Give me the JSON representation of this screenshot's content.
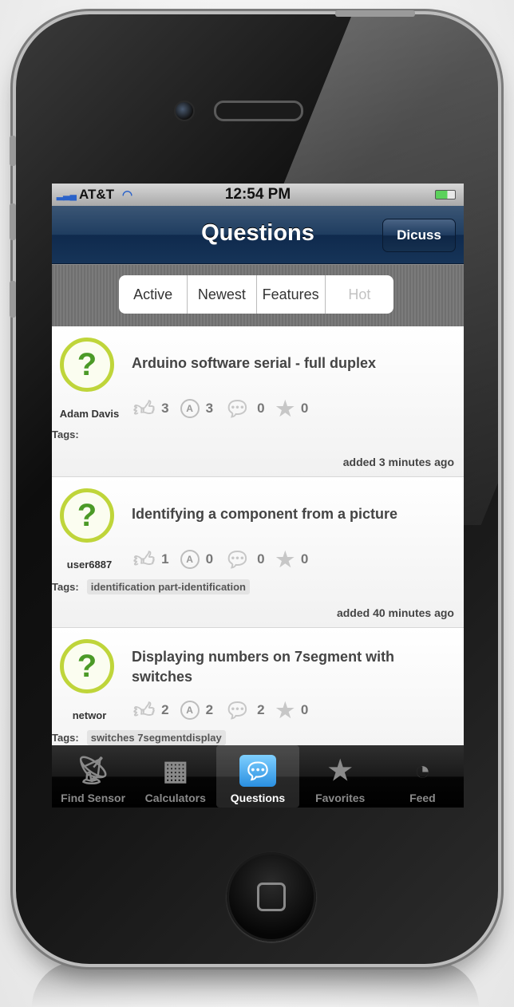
{
  "status_bar": {
    "carrier": "AT&T",
    "time": "12:54 PM"
  },
  "nav": {
    "title": "Questions",
    "right_button": "Dicuss"
  },
  "segments": [
    {
      "label": "Active"
    },
    {
      "label": "Newest"
    },
    {
      "label": "Features"
    },
    {
      "label": "Hot"
    }
  ],
  "questions": [
    {
      "title": "Arduino software serial - full duplex",
      "user": "Adam Davis",
      "likes": "3",
      "answers": "3",
      "comments": "0",
      "favorites": "0",
      "tags_label": "Tags:",
      "tags": "",
      "added": "added 3 minutes ago"
    },
    {
      "title": "Identifying a component from a picture",
      "user": "user6887",
      "likes": "1",
      "answers": "0",
      "comments": "0",
      "favorites": "0",
      "tags_label": "Tags:",
      "tags": "identification part-identification",
      "added": "added 40 minutes ago"
    },
    {
      "title": "Displaying numbers on 7segment with switches",
      "user": "networ",
      "likes": "2",
      "answers": "2",
      "comments": "2",
      "favorites": "0",
      "tags_label": "Tags:",
      "tags": "switches 7segmentdisplay",
      "added": ""
    }
  ],
  "tabs": [
    {
      "label": "Find Sensor",
      "icon": "antenna-icon"
    },
    {
      "label": "Calculators",
      "icon": "calculator-icon"
    },
    {
      "label": "Questions",
      "icon": "chat-bubbles-icon"
    },
    {
      "label": "Favorites",
      "icon": "star-icon"
    },
    {
      "label": "Feed",
      "icon": "rss-icon"
    }
  ],
  "colors": {
    "nav_dark": "#0f2a4d",
    "question_ring": "#bfd53a",
    "question_mark": "#4b9a27",
    "active_tab": "#2a8fe0"
  }
}
